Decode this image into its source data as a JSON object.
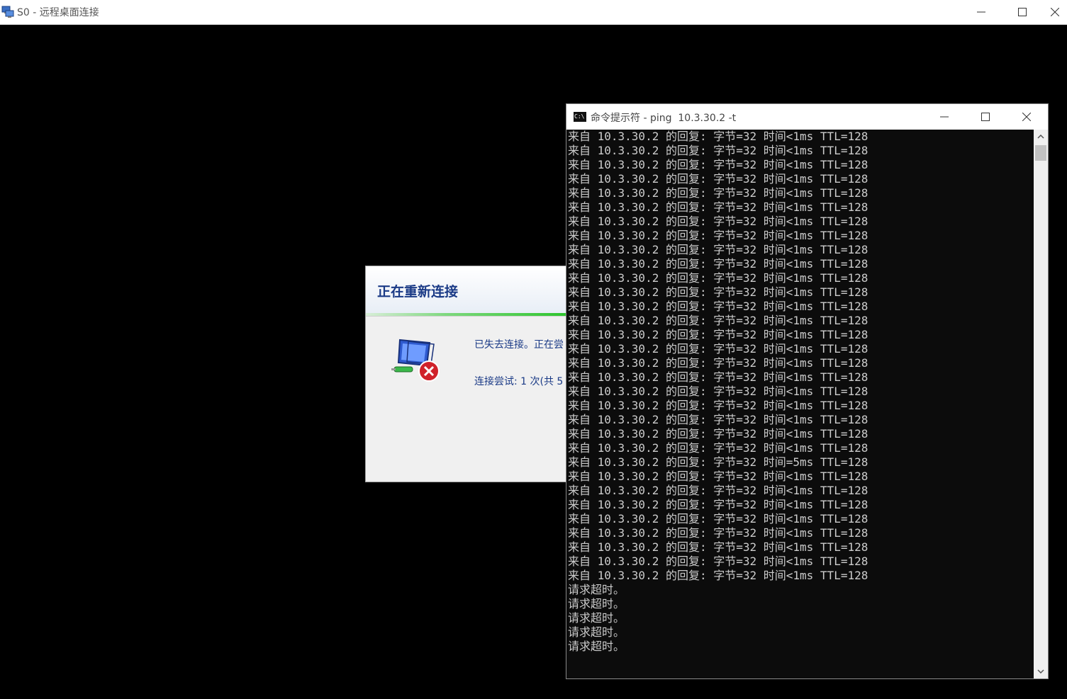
{
  "rdp_window": {
    "title": "S0 - 远程桌面连接",
    "app_icon": "remote-desktop-icon"
  },
  "dialog": {
    "title": "正在重新连接",
    "message": "已失去连接。正在尝",
    "attempt": "连接尝试: 1 次(共 5",
    "icon": "network-disconnected-icon"
  },
  "cmd_window": {
    "title": "命令提示符 - ping  10.3.30.2 -t",
    "icon": "cmd-icon",
    "lines": [
      "来自 10.3.30.2 的回复: 字节=32 时间<1ms TTL=128",
      "来自 10.3.30.2 的回复: 字节=32 时间<1ms TTL=128",
      "来自 10.3.30.2 的回复: 字节=32 时间<1ms TTL=128",
      "来自 10.3.30.2 的回复: 字节=32 时间<1ms TTL=128",
      "来自 10.3.30.2 的回复: 字节=32 时间<1ms TTL=128",
      "来自 10.3.30.2 的回复: 字节=32 时间<1ms TTL=128",
      "来自 10.3.30.2 的回复: 字节=32 时间<1ms TTL=128",
      "来自 10.3.30.2 的回复: 字节=32 时间<1ms TTL=128",
      "来自 10.3.30.2 的回复: 字节=32 时间<1ms TTL=128",
      "来自 10.3.30.2 的回复: 字节=32 时间<1ms TTL=128",
      "来自 10.3.30.2 的回复: 字节=32 时间<1ms TTL=128",
      "来自 10.3.30.2 的回复: 字节=32 时间<1ms TTL=128",
      "来自 10.3.30.2 的回复: 字节=32 时间<1ms TTL=128",
      "来自 10.3.30.2 的回复: 字节=32 时间<1ms TTL=128",
      "来自 10.3.30.2 的回复: 字节=32 时间<1ms TTL=128",
      "来自 10.3.30.2 的回复: 字节=32 时间<1ms TTL=128",
      "来自 10.3.30.2 的回复: 字节=32 时间<1ms TTL=128",
      "来自 10.3.30.2 的回复: 字节=32 时间<1ms TTL=128",
      "来自 10.3.30.2 的回复: 字节=32 时间<1ms TTL=128",
      "来自 10.3.30.2 的回复: 字节=32 时间<1ms TTL=128",
      "来自 10.3.30.2 的回复: 字节=32 时间<1ms TTL=128",
      "来自 10.3.30.2 的回复: 字节=32 时间<1ms TTL=128",
      "来自 10.3.30.2 的回复: 字节=32 时间<1ms TTL=128",
      "来自 10.3.30.2 的回复: 字节=32 时间=5ms TTL=128",
      "来自 10.3.30.2 的回复: 字节=32 时间<1ms TTL=128",
      "来自 10.3.30.2 的回复: 字节=32 时间<1ms TTL=128",
      "来自 10.3.30.2 的回复: 字节=32 时间<1ms TTL=128",
      "来自 10.3.30.2 的回复: 字节=32 时间<1ms TTL=128",
      "来自 10.3.30.2 的回复: 字节=32 时间<1ms TTL=128",
      "来自 10.3.30.2 的回复: 字节=32 时间<1ms TTL=128",
      "来自 10.3.30.2 的回复: 字节=32 时间<1ms TTL=128",
      "来自 10.3.30.2 的回复: 字节=32 时间<1ms TTL=128",
      "请求超时。",
      "请求超时。",
      "请求超时。",
      "请求超时。",
      "请求超时。"
    ]
  },
  "colors": {
    "desktop_bg": "#000000",
    "console_bg": "#0c0c0c",
    "console_text": "#cccccc",
    "dialog_title": "#1a3a86"
  }
}
